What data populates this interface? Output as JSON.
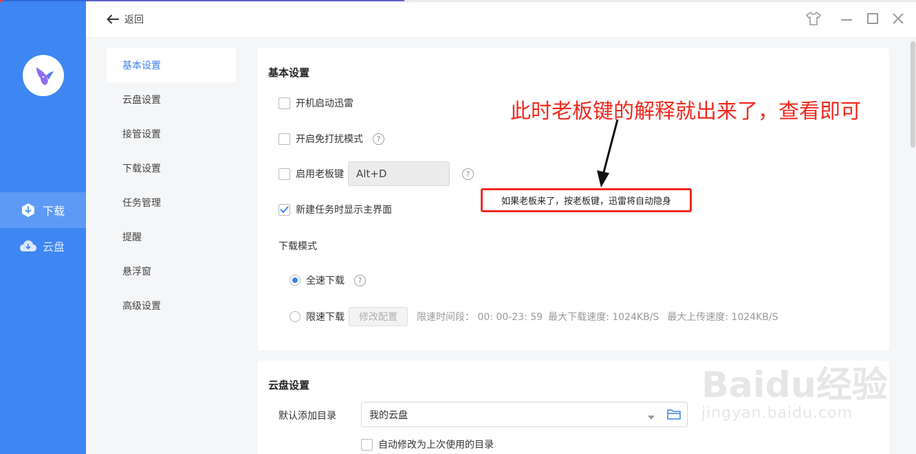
{
  "nav": {
    "items": [
      {
        "label": "下载",
        "icon": "download-shield-icon",
        "active": true
      },
      {
        "label": "云盘",
        "icon": "cloud-icon",
        "active": false
      }
    ]
  },
  "topbar": {
    "back_label": "返回"
  },
  "submenu": {
    "items": [
      {
        "label": "基本设置",
        "active": true
      },
      {
        "label": "云盘设置"
      },
      {
        "label": "接管设置"
      },
      {
        "label": "下载设置"
      },
      {
        "label": "任务管理"
      },
      {
        "label": "提醒"
      },
      {
        "label": "悬浮窗"
      },
      {
        "label": "高级设置"
      }
    ]
  },
  "basic": {
    "title": "基本设置",
    "autostart_label": "开机启动迅雷",
    "dnd_label": "开启免打扰模式",
    "bosskey_label": "启用老板键",
    "bosskey_value": "Alt+D",
    "show_main_label": "新建任务时显示主界面",
    "download_mode_label": "下载模式",
    "fullspeed_label": "全速下载",
    "limited_label": "限速下载",
    "modify_config_label": "修改配置",
    "limit_time": "限速时间段： 00: 00-23: 59",
    "max_download": "最大下载速度: 1024KB/S",
    "max_upload": "最大上传速度: 1024KB/S",
    "checkbox_states": {
      "autostart": false,
      "dnd": false,
      "bosskey": false,
      "show_main": true
    },
    "selected_mode": "全速下载"
  },
  "cloud": {
    "title": "云盘设置",
    "default_dir_label": "默认添加目录",
    "default_dir_value": "我的云盘",
    "auto_modify_label": "自动修改为上次使用的目录"
  },
  "annotation": {
    "headline": "此时老板键的解释就出来了，查看即可",
    "tooltip": "如果老板来了，按老板键，迅雷将自动隐身",
    "color": "#f2281e"
  },
  "watermark": {
    "main": "Baidu经验",
    "sub": "jingyan.baidu.com"
  },
  "colors": {
    "rail": "#3e86f2",
    "accent": "#3b82f0"
  }
}
